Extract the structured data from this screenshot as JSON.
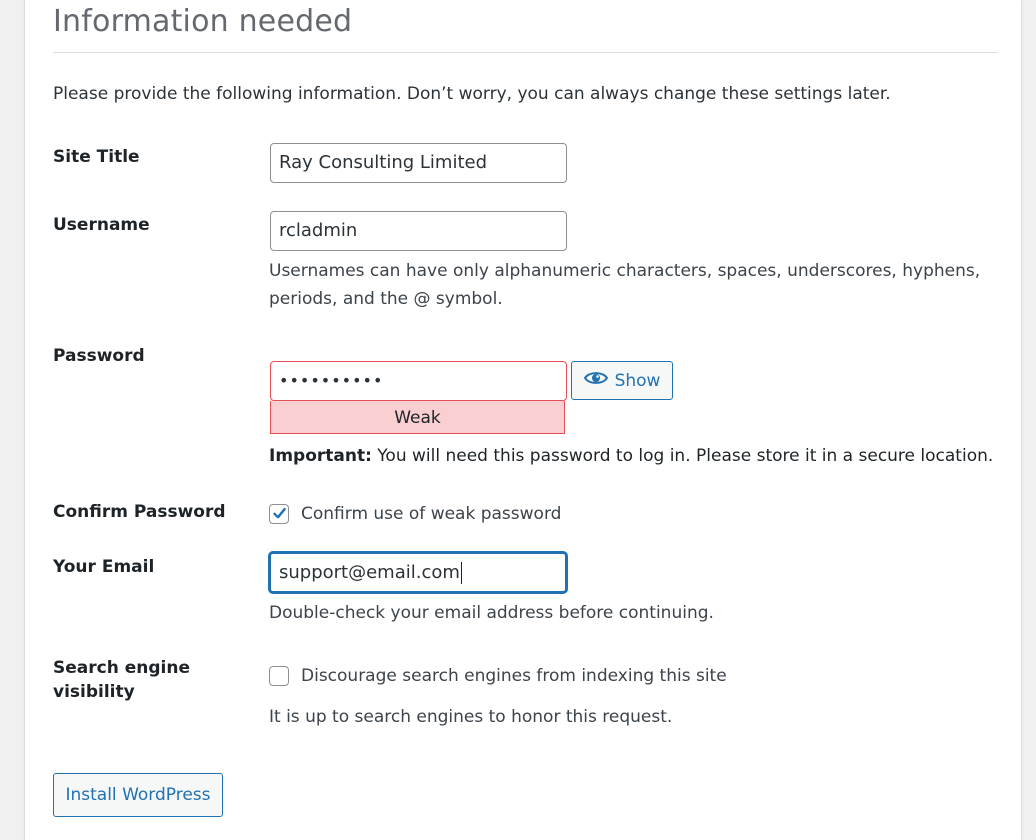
{
  "heading": "Information needed",
  "intro": "Please provide the following information. Don’t worry, you can always change these settings later.",
  "fields": {
    "site_title": {
      "label": "Site Title",
      "value": "Ray Consulting Limited"
    },
    "username": {
      "label": "Username",
      "value": "rcladmin",
      "description_line1": "Usernames can have only alphanumeric characters, spaces, underscores, hyphens,",
      "description_line2": "periods, and the @ symbol."
    },
    "password": {
      "label": "Password",
      "value_masked": "••••••••••",
      "strength": "Weak",
      "show_label": "Show",
      "show_icon": "eye-icon",
      "important_label": "Important:",
      "important_text": " You will need this password to log in. Please store it in a secure location."
    },
    "confirm_password": {
      "label": "Confirm Password",
      "checkbox_label": "Confirm use of weak password",
      "checked": true
    },
    "email": {
      "label": "Your Email",
      "value": "support@email.com",
      "description": "Double-check your email address before continuing."
    },
    "search_visibility": {
      "label_line1": "Search engine",
      "label_line2": "visibility",
      "checkbox_label": "Discourage search engines from indexing this site",
      "checked": false,
      "description": "It is up to search engines to honor this request."
    }
  },
  "install_button": "Install WordPress",
  "colors": {
    "accent": "#2271b1",
    "weak_bg": "#facfd2",
    "weak_border": "#e65054",
    "page_bg": "#f0f0f1"
  }
}
